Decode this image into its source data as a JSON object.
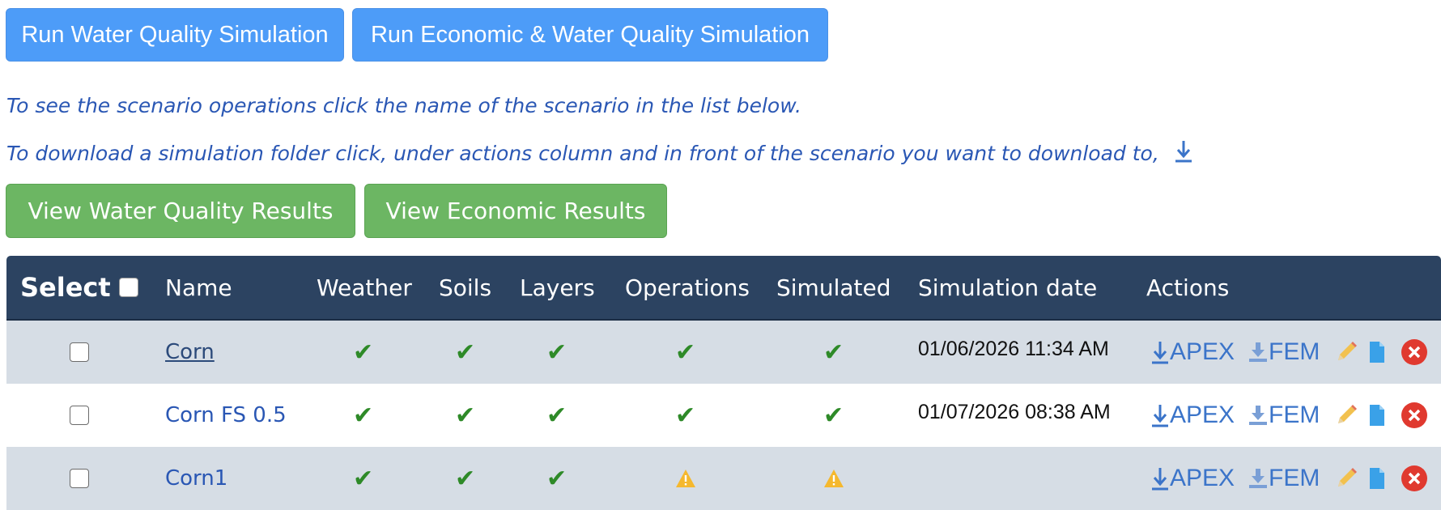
{
  "toolbar": {
    "run_wq_label": "Run Water Quality Simulation",
    "run_econ_wq_label": "Run Economic & Water Quality Simulation"
  },
  "info": {
    "line1": "To see the scenario operations click the name of the scenario in the list below.",
    "line2": "To download a simulation folder click, under actions column and in front of the scenario you want to download to,"
  },
  "results": {
    "view_wq_label": "View Water Quality Results",
    "view_econ_label": "View Economic Results"
  },
  "table": {
    "headers": {
      "select": "Select",
      "name": "Name",
      "weather": "Weather",
      "soils": "Soils",
      "layers": "Layers",
      "operations": "Operations",
      "simulated": "Simulated",
      "simulation_date": "Simulation date",
      "actions": "Actions"
    },
    "rows": [
      {
        "name": "Corn",
        "weather": "check",
        "soils": "check",
        "layers": "check",
        "operations": "check",
        "simulated": "check",
        "simulation_date": "01/06/2026 11:34 AM",
        "apex": "APEX",
        "fem": "FEM"
      },
      {
        "name": "Corn FS 0.5",
        "weather": "check",
        "soils": "check",
        "layers": "check",
        "operations": "check",
        "simulated": "check",
        "simulation_date": "01/07/2026 08:38 AM",
        "apex": "APEX",
        "fem": "FEM"
      },
      {
        "name": "Corn1",
        "weather": "check",
        "soils": "check",
        "layers": "check",
        "operations": "warning",
        "simulated": "warning",
        "simulation_date": "",
        "apex": "APEX",
        "fem": "FEM"
      }
    ]
  },
  "colors": {
    "run_button": "#4d9cf8",
    "results_button": "#6cb663",
    "header_bg": "#2c4361",
    "link": "#2a57b4",
    "check": "#2e8a28",
    "warning": "#f5b82e",
    "delete": "#e0392f"
  },
  "icons": {
    "status_ok": "checkmark-icon",
    "status_warn": "warning-icon",
    "download_apex": "download-arrow-icon",
    "download_fem": "download-tray-icon",
    "edit": "pencil-icon",
    "copy": "document-copy-icon",
    "delete": "delete-x-icon"
  }
}
